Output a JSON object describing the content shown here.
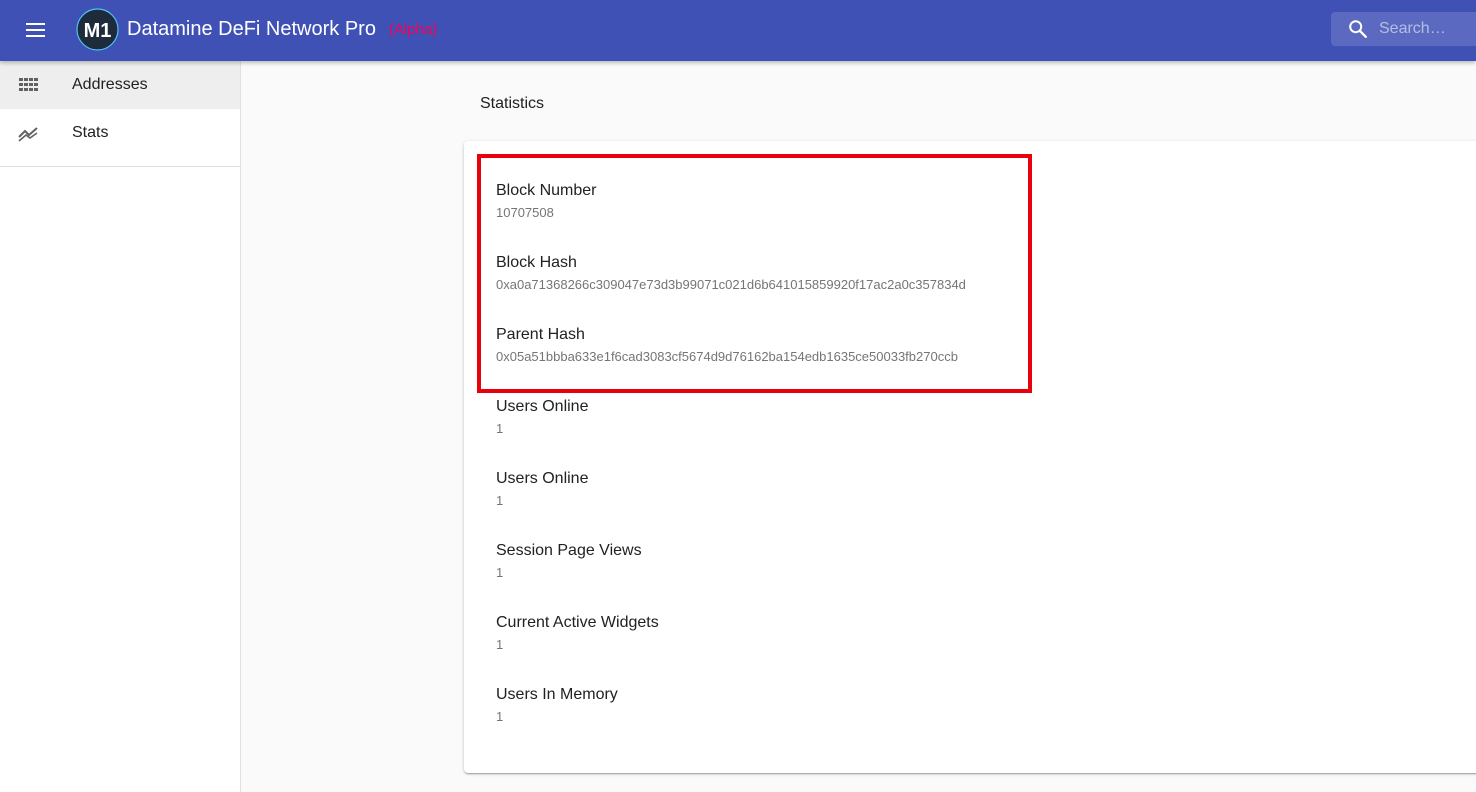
{
  "app": {
    "title": "Datamine DeFi Network Pro",
    "badge": "(Alpha)",
    "logo_text": "M1",
    "brand_color": "#3f51b5",
    "badge_color": "#f50057",
    "menu_icon": "hamburger-menu-icon"
  },
  "search": {
    "placeholder": "Search…",
    "value": "",
    "icon": "search-icon"
  },
  "sidebar": {
    "items": [
      {
        "label": "Addresses",
        "icon": "grid-icon",
        "active": true
      },
      {
        "label": "Stats",
        "icon": "trending-icon",
        "active": false
      }
    ]
  },
  "page": {
    "heading": "Statistics"
  },
  "stats": [
    {
      "label": "Block Number",
      "value": "10707508"
    },
    {
      "label": "Block Hash",
      "value": "0xa0a71368266c309047e73d3b99071c021d6b641015859920f17ac2a0c357834d"
    },
    {
      "label": "Parent Hash",
      "value": "0x05a51bbba633e1f6cad3083cf5674d9d76162ba154edb1635ce50033fb270ccb"
    },
    {
      "label": "Users Online",
      "value": "1"
    },
    {
      "label": "Users Online",
      "value": "1"
    },
    {
      "label": "Session Page Views",
      "value": "1"
    },
    {
      "label": "Current Active Widgets",
      "value": "1"
    },
    {
      "label": "Users In Memory",
      "value": "1"
    }
  ],
  "annotation": {
    "highlight_color": "#e8000c"
  }
}
